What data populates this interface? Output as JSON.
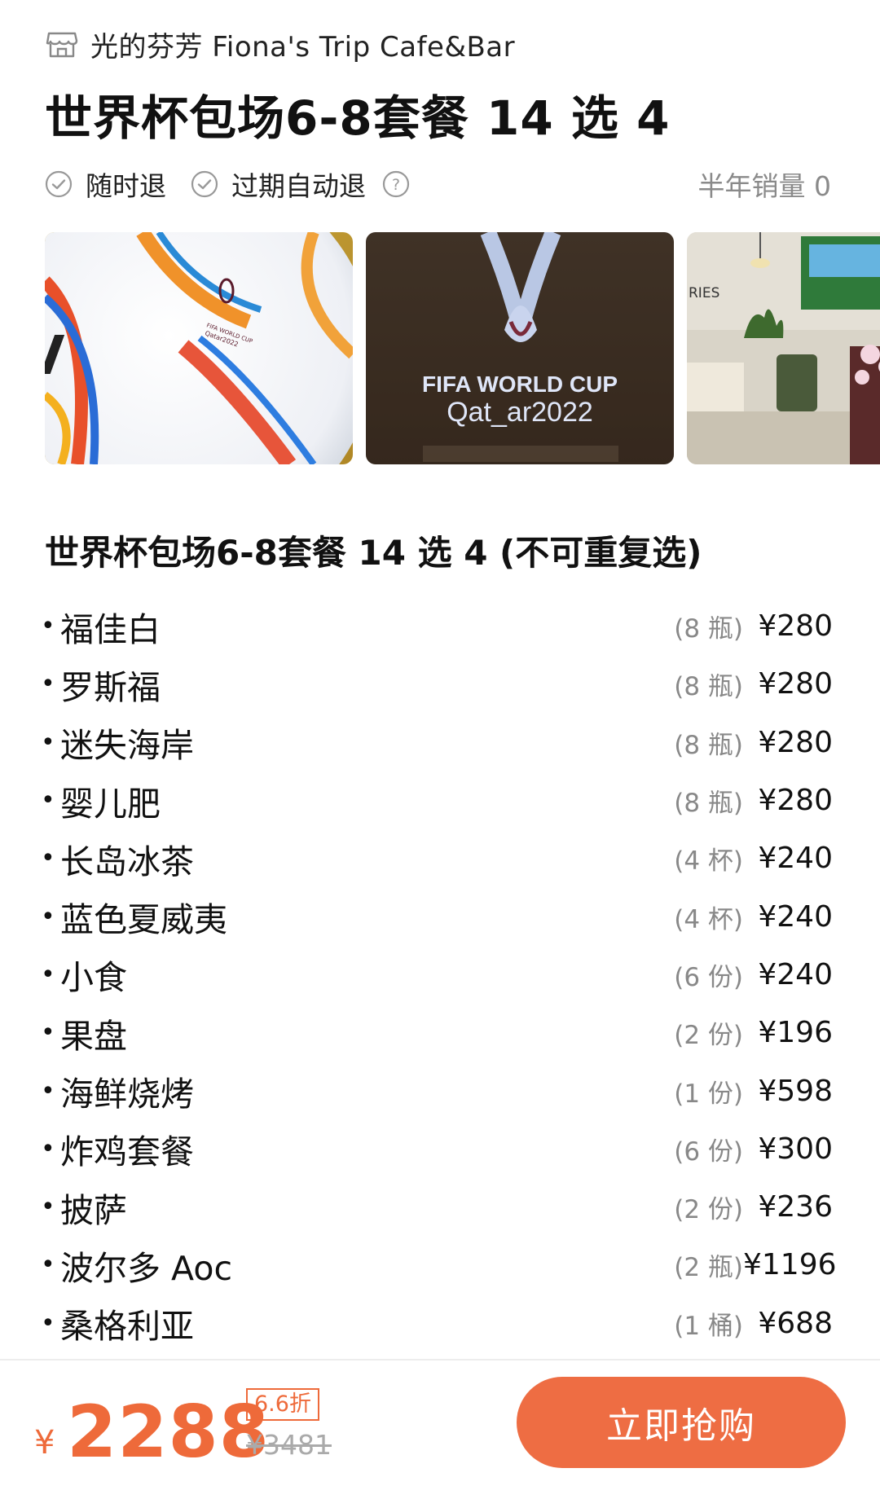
{
  "header": {
    "shop_icon": "storefront-icon",
    "shop_name": "光的芬芳 Fiona's Trip Cafe&Bar",
    "title": "世界杯包场6-8套餐 14 选 4"
  },
  "tags": [
    {
      "icon": "check-circle-icon",
      "label": "随时退"
    },
    {
      "icon": "check-circle-icon",
      "label": "过期自动退"
    }
  ],
  "help_icon": "question-circle-icon",
  "sales": "半年销量 0",
  "gallery": {
    "photos": [
      "soccer-ball-photo",
      "fifa-world-cup-qatar-photo",
      "cafe-interior-photo"
    ],
    "photo2_text_line1": "FIFA WORLD CUP",
    "photo2_text_line2": "Qat_ar2022",
    "photo3_text": "RIES"
  },
  "section_title": "世界杯包场6-8套餐 14 选 4 (不可重复选)",
  "menu": [
    {
      "name": "福佳白",
      "qty": "(8 瓶)",
      "price": "¥280"
    },
    {
      "name": "罗斯福",
      "qty": "(8 瓶)",
      "price": "¥280"
    },
    {
      "name": "迷失海岸",
      "qty": "(8 瓶)",
      "price": "¥280"
    },
    {
      "name": "婴儿肥",
      "qty": "(8 瓶)",
      "price": "¥280"
    },
    {
      "name": "长岛冰茶",
      "qty": "(4 杯)",
      "price": "¥240"
    },
    {
      "name": "蓝色夏威夷",
      "qty": "(4 杯)",
      "price": "¥240"
    },
    {
      "name": "小食",
      "qty": "(6 份)",
      "price": "¥240"
    },
    {
      "name": "果盘",
      "qty": "(2 份)",
      "price": "¥196"
    },
    {
      "name": "海鲜烧烤",
      "qty": "(1 份)",
      "price": "¥598"
    },
    {
      "name": "炸鸡套餐",
      "qty": "(6 份)",
      "price": "¥300"
    },
    {
      "name": "披萨",
      "qty": "(2 份)",
      "price": "¥236"
    },
    {
      "name": "波尔多 Aoc",
      "qty": "(2 瓶)",
      "price": "¥1196"
    },
    {
      "name": "桑格利亚",
      "qty": "(1 桶)",
      "price": "¥688"
    }
  ],
  "bottom": {
    "currency": "¥",
    "price": "2288",
    "discount": "6.6折",
    "original_price": "¥3481",
    "buy_label": "立即抢购"
  },
  "colors": {
    "accent": "#ee6d43",
    "muted": "#8a8a8a"
  }
}
